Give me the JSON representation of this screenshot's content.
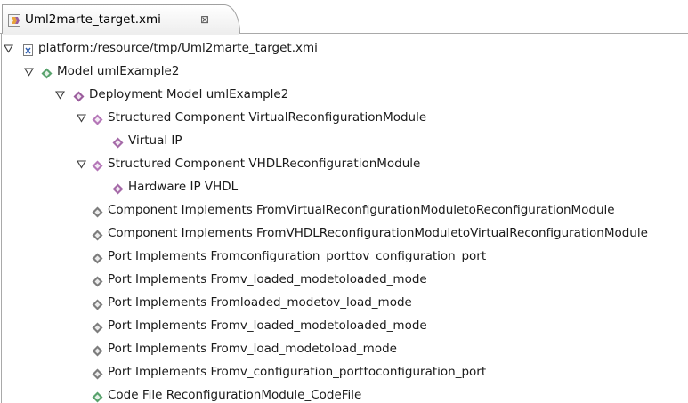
{
  "tab": {
    "title": "Uml2marte_target.xmi",
    "close_glyph": "⊠",
    "icon": "xmi-editor-icon"
  },
  "tree": [
    {
      "label": "platform:/resource/tmp/Uml2marte_target.xmi",
      "expanded": true,
      "icon": "xmi-resource-icon",
      "color": "#2f5fb0"
    },
    {
      "label": "Model umlExample2",
      "expanded": true,
      "icon": "diamond-icon",
      "color": "#58a26c"
    },
    {
      "label": "Deployment Model umlExample2",
      "expanded": true,
      "icon": "diamond-icon",
      "color": "#9b5d9d"
    },
    {
      "label": "Structured Component VirtualReconfigurationModule",
      "expanded": true,
      "icon": "diamond-icon",
      "color": "#b577b8"
    },
    {
      "label": "Virtual IP",
      "expanded": null,
      "icon": "diamond-icon",
      "color": "#a56aa8"
    },
    {
      "label": "Structured Component VHDLReconfigurationModule",
      "expanded": true,
      "icon": "diamond-icon",
      "color": "#b577b8"
    },
    {
      "label": "Hardware IP VHDL",
      "expanded": null,
      "icon": "diamond-icon",
      "color": "#a56aa8"
    },
    {
      "label": "Component Implements FromVirtualReconfigurationModuletoReconfigurationModule",
      "expanded": null,
      "icon": "diamond-icon",
      "color": "#7d7d7d"
    },
    {
      "label": "Component Implements FromVHDLReconfigurationModuletoVirtualReconfigurationModule",
      "expanded": null,
      "icon": "diamond-icon",
      "color": "#7d7d7d"
    },
    {
      "label": "Port Implements Fromconfiguration_porttov_configuration_port",
      "expanded": null,
      "icon": "diamond-icon",
      "color": "#7d7d7d"
    },
    {
      "label": "Port Implements Fromv_loaded_modetoloaded_mode",
      "expanded": null,
      "icon": "diamond-icon",
      "color": "#7d7d7d"
    },
    {
      "label": "Port Implements Fromloaded_modetov_load_mode",
      "expanded": null,
      "icon": "diamond-icon",
      "color": "#7d7d7d"
    },
    {
      "label": "Port Implements Fromv_loaded_modetoloaded_mode",
      "expanded": null,
      "icon": "diamond-icon",
      "color": "#7d7d7d"
    },
    {
      "label": "Port Implements Fromv_load_modetoload_mode",
      "expanded": null,
      "icon": "diamond-icon",
      "color": "#7d7d7d"
    },
    {
      "label": "Port Implements Fromv_configuration_porttoconfiguration_port",
      "expanded": null,
      "icon": "diamond-icon",
      "color": "#7d7d7d"
    },
    {
      "label": "Code File ReconfigurationModule_CodeFile",
      "expanded": null,
      "icon": "diamond-icon",
      "color": "#58a26c"
    }
  ]
}
